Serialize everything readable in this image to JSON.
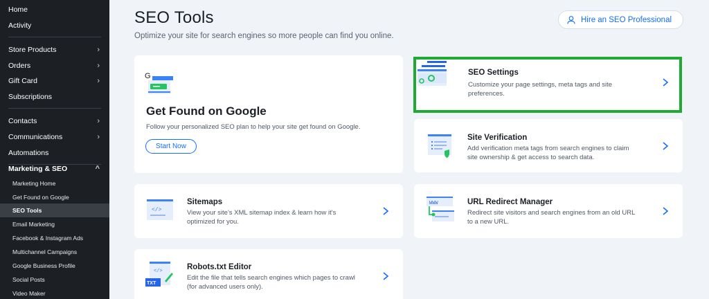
{
  "sidebar": {
    "items": [
      {
        "label": "Home",
        "chevron": false
      },
      {
        "label": "Activity",
        "chevron": false
      },
      {
        "label": "Store Products",
        "chevron": true
      },
      {
        "label": "Orders",
        "chevron": true
      },
      {
        "label": "Gift Card",
        "chevron": true
      },
      {
        "label": "Subscriptions",
        "chevron": false
      },
      {
        "label": "Contacts",
        "chevron": true
      },
      {
        "label": "Communications",
        "chevron": true
      },
      {
        "label": "Automations",
        "chevron": false
      },
      {
        "label": "Marketing & SEO",
        "chevron": true
      }
    ],
    "chevron_right": "›",
    "chevron_up": "^",
    "subitems": [
      {
        "label": "Marketing Home"
      },
      {
        "label": "Get Found on Google"
      },
      {
        "label": "SEO Tools"
      },
      {
        "label": "Email Marketing"
      },
      {
        "label": "Facebook & Instagram Ads"
      },
      {
        "label": "Multichannel Campaigns"
      },
      {
        "label": "Google Business Profile"
      },
      {
        "label": "Social Posts"
      },
      {
        "label": "Video Maker"
      }
    ],
    "active_subitem": "SEO Tools"
  },
  "header": {
    "title": "SEO Tools",
    "subtitle": "Optimize your site for search engines so more people can find you online.",
    "hire_button": "Hire an SEO Professional"
  },
  "google_card": {
    "title": "Get Found on Google",
    "description": "Follow your personalized SEO plan to help your site get found on Google.",
    "button": "Start Now",
    "thumb_letter": "G"
  },
  "tools": [
    {
      "title": "SEO Settings",
      "description": "Customize your page settings, meta tags and site preferences."
    },
    {
      "title": "Site Verification",
      "description": "Add verification meta tags from search engines to claim site ownership & get access to search data."
    },
    {
      "title": "Sitemaps",
      "description": "View your site's XML sitemap index & learn how it's optimized for you."
    },
    {
      "title": "URL Redirect Manager",
      "description": "Redirect site visitors and search engines from an old URL to a new URL."
    },
    {
      "title": "Robots.txt Editor",
      "description": "Edit the file that tells search engines which pages to crawl (for advanced users only)."
    }
  ],
  "thumb_text": {
    "code": "</>",
    "txt": "TXT",
    "www": "WWW"
  },
  "colors": {
    "sidebar_bg": "#1c1f24",
    "accent_blue": "#116dff",
    "highlight_green": "#1faa34",
    "page_bg": "#f0f4f8"
  },
  "icons": {
    "hire": "user-icon",
    "arrow": "chevron-right-icon"
  }
}
